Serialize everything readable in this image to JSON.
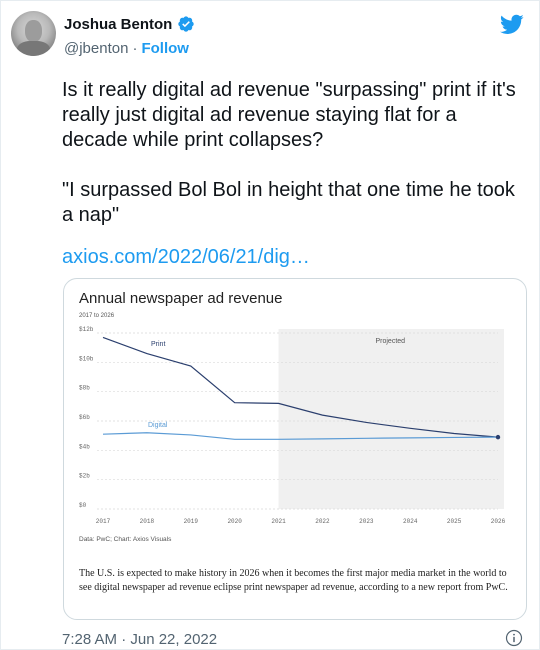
{
  "user": {
    "name": "Joshua Benton",
    "handle": "@jbenton",
    "separator": "·",
    "follow_label": "Follow"
  },
  "tweet": {
    "text": "Is it really digital ad revenue \"surpassing\" print if it's really just digital ad revenue staying flat for a decade while print collapses?\n\n\"I surpassed Bol Bol in height that one time he took a nap\"",
    "link": "axios.com/2022/06/21/dig…",
    "timestamp": "7:28 AM · Jun 22, 2022"
  },
  "card": {
    "caption": "The U.S. is expected to make history in 2026 when it becomes the first major media market in the world to see digital newspaper ad revenue eclipse print newspaper ad revenue, according to a new report from PwC.",
    "source": "Data: PwC; Chart: Axios Visuals"
  },
  "chart_data": {
    "type": "line",
    "title": "Annual newspaper ad revenue",
    "subtitle": "2017 to 2026",
    "x": [
      2017,
      2018,
      2019,
      2020,
      2021,
      2022,
      2023,
      2024,
      2025,
      2026
    ],
    "series": [
      {
        "name": "Print",
        "values": [
          11.7,
          10.6,
          9.75,
          7.25,
          7.2,
          6.4,
          5.9,
          5.5,
          5.15,
          4.9
        ]
      },
      {
        "name": "Digital",
        "values": [
          5.1,
          5.2,
          5.05,
          4.75,
          4.75,
          4.78,
          4.82,
          4.85,
          4.88,
          4.9
        ]
      }
    ],
    "y_ticks": [
      "$0",
      "$2b",
      "$4b",
      "$6b",
      "$8b",
      "$10b",
      "$12b"
    ],
    "y_tick_values": [
      0,
      2,
      4,
      6,
      8,
      10,
      12
    ],
    "ylim": [
      0,
      12
    ],
    "projected_label": "Projected",
    "projected_from": 2021,
    "colors": {
      "print": "#2b3f6e",
      "digital": "#5b9bd5",
      "projected_bg": "#f0f0f0"
    },
    "grid": true
  },
  "icons": {
    "verified": "verified-badge-icon",
    "twitter": "twitter-bird-icon",
    "info": "info-icon"
  }
}
